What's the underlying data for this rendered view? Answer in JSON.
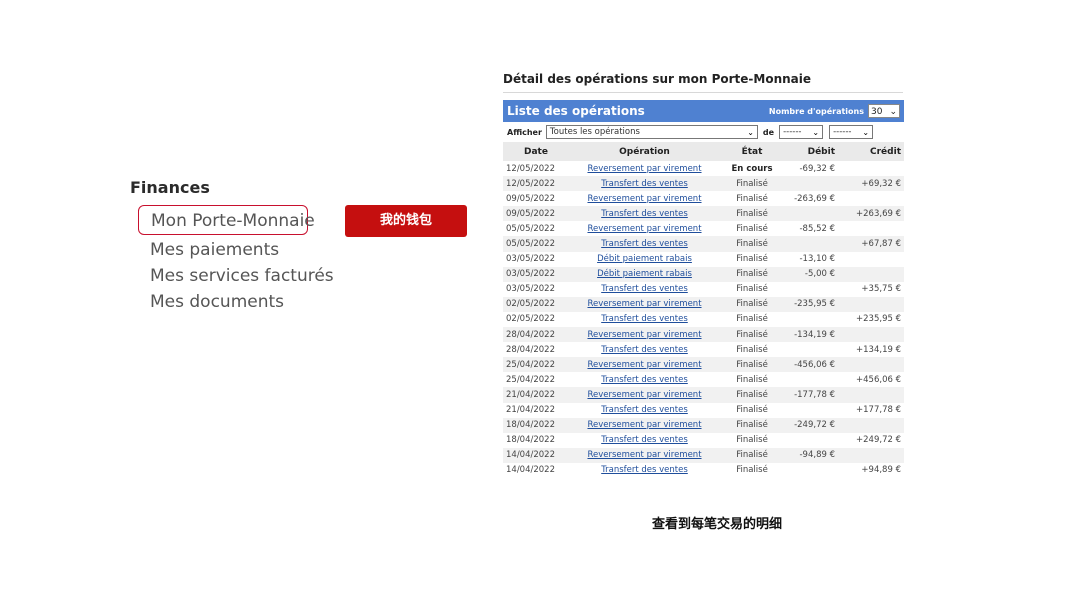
{
  "finances": {
    "title": "Finances",
    "items": [
      {
        "label": "Mon Porte-Monnaie"
      },
      {
        "label": "Mes paiements"
      },
      {
        "label": "Mes services facturés"
      },
      {
        "label": "Mes documents"
      }
    ],
    "tag": "我的钱包"
  },
  "panel": {
    "heading": "Détail des opérations sur mon Porte-Monnaie",
    "list_title": "Liste des opérations",
    "count_label": "Nombre d'opérations",
    "count_value": "30",
    "filter_label": "Afficher",
    "filter_value": "Toutes les opérations",
    "de_label": "de",
    "date_from": "------",
    "date_to": "------",
    "columns": [
      "Date",
      "Opération",
      "État",
      "Débit",
      "Crédit"
    ],
    "rows": [
      {
        "date": "12/05/2022",
        "op": "Reversement par virement",
        "etat": "En cours",
        "debit": "-69,32 €",
        "credit": ""
      },
      {
        "date": "12/05/2022",
        "op": "Transfert des ventes",
        "etat": "Finalisé",
        "debit": "",
        "credit": "+69,32 €"
      },
      {
        "date": "09/05/2022",
        "op": "Reversement par virement",
        "etat": "Finalisé",
        "debit": "-263,69 €",
        "credit": ""
      },
      {
        "date": "09/05/2022",
        "op": "Transfert des ventes",
        "etat": "Finalisé",
        "debit": "",
        "credit": "+263,69 €"
      },
      {
        "date": "05/05/2022",
        "op": "Reversement par virement",
        "etat": "Finalisé",
        "debit": "-85,52 €",
        "credit": ""
      },
      {
        "date": "05/05/2022",
        "op": "Transfert des ventes",
        "etat": "Finalisé",
        "debit": "",
        "credit": "+67,87 €"
      },
      {
        "date": "03/05/2022",
        "op": "Débit paiement rabais",
        "etat": "Finalisé",
        "debit": "-13,10 €",
        "credit": ""
      },
      {
        "date": "03/05/2022",
        "op": "Débit paiement rabais",
        "etat": "Finalisé",
        "debit": "-5,00 €",
        "credit": ""
      },
      {
        "date": "03/05/2022",
        "op": "Transfert des ventes",
        "etat": "Finalisé",
        "debit": "",
        "credit": "+35,75 €"
      },
      {
        "date": "02/05/2022",
        "op": "Reversement par virement",
        "etat": "Finalisé",
        "debit": "-235,95 €",
        "credit": ""
      },
      {
        "date": "02/05/2022",
        "op": "Transfert des ventes",
        "etat": "Finalisé",
        "debit": "",
        "credit": "+235,95 €"
      },
      {
        "date": "28/04/2022",
        "op": "Reversement par virement",
        "etat": "Finalisé",
        "debit": "-134,19 €",
        "credit": ""
      },
      {
        "date": "28/04/2022",
        "op": "Transfert des ventes",
        "etat": "Finalisé",
        "debit": "",
        "credit": "+134,19 €"
      },
      {
        "date": "25/04/2022",
        "op": "Reversement par virement",
        "etat": "Finalisé",
        "debit": "-456,06 €",
        "credit": ""
      },
      {
        "date": "25/04/2022",
        "op": "Transfert des ventes",
        "etat": "Finalisé",
        "debit": "",
        "credit": "+456,06 €"
      },
      {
        "date": "21/04/2022",
        "op": "Reversement par virement",
        "etat": "Finalisé",
        "debit": "-177,78 €",
        "credit": ""
      },
      {
        "date": "21/04/2022",
        "op": "Transfert des ventes",
        "etat": "Finalisé",
        "debit": "",
        "credit": "+177,78 €"
      },
      {
        "date": "18/04/2022",
        "op": "Reversement par virement",
        "etat": "Finalisé",
        "debit": "-249,72 €",
        "credit": ""
      },
      {
        "date": "18/04/2022",
        "op": "Transfert des ventes",
        "etat": "Finalisé",
        "debit": "",
        "credit": "+249,72 €"
      },
      {
        "date": "14/04/2022",
        "op": "Reversement par virement",
        "etat": "Finalisé",
        "debit": "-94,89 €",
        "credit": ""
      },
      {
        "date": "14/04/2022",
        "op": "Transfert des ventes",
        "etat": "Finalisé",
        "debit": "",
        "credit": "+94,89 €"
      }
    ]
  },
  "caption": "查看到每笔交易的明细",
  "colors": {
    "accent_red": "#c50f0f",
    "table_header_blue": "#4f81d1",
    "link_blue": "#1f4e9c"
  },
  "icons": {
    "select_arrow": "chevron-down-icon"
  }
}
